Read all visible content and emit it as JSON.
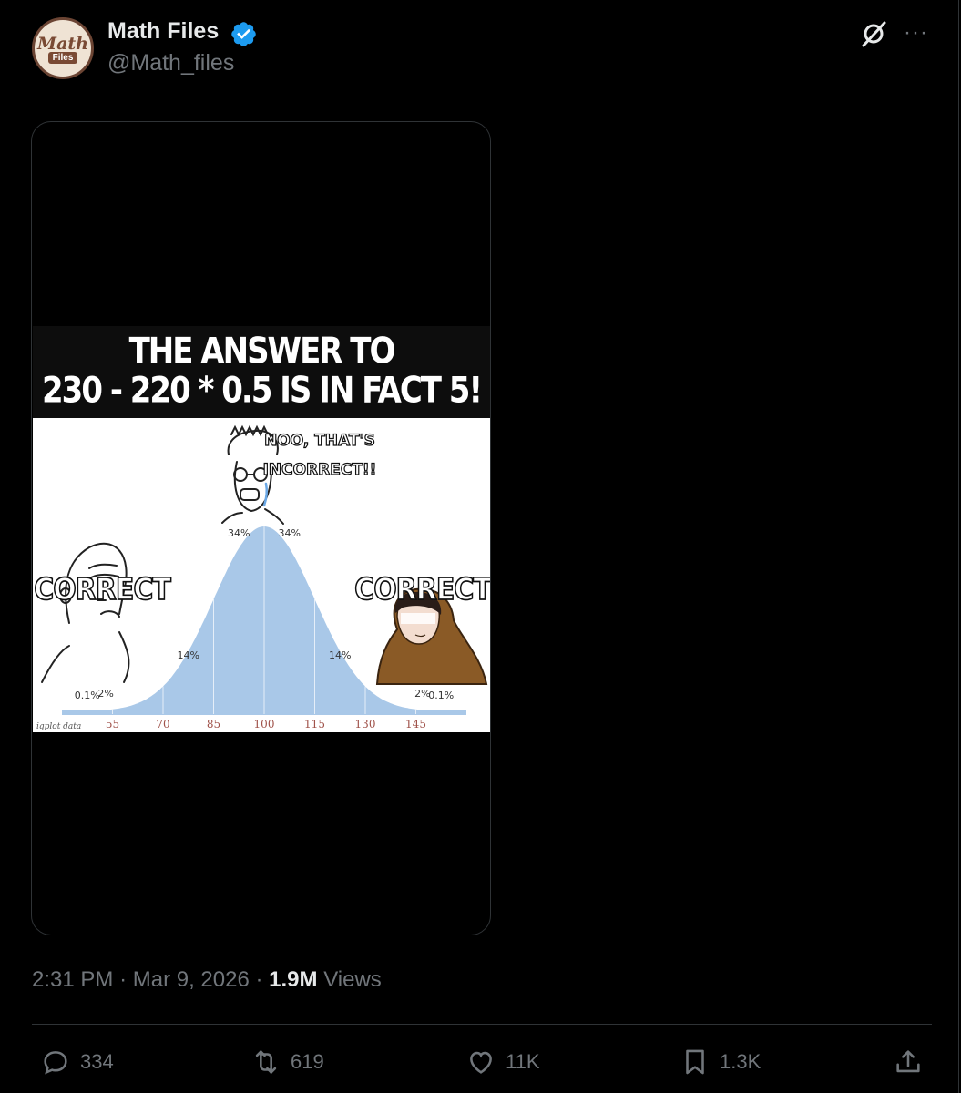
{
  "author": {
    "name": "Math Files",
    "handle": "@Math_files",
    "avatar_text_1": "Math",
    "avatar_text_2": "Files",
    "verified_icon": "verified-badge-icon"
  },
  "meme": {
    "headline_line1": "THE ANSWER TO",
    "headline_line2": "230 - 220 * 0.5 IS IN FACT 5!",
    "center_caption_line1": "NOO, THAT'S",
    "center_caption_line2": "INCORRECT!!",
    "left_caption": "CORRECT",
    "right_caption": "CORRECT",
    "footer_small_text": "iqplot data"
  },
  "chart_data": {
    "type": "area",
    "x_ticks": [
      "55",
      "70",
      "85",
      "100",
      "115",
      "130",
      "145"
    ],
    "regions": [
      {
        "label": "0.1%"
      },
      {
        "label": "2%"
      },
      {
        "label": "14%"
      },
      {
        "label": "34%"
      },
      {
        "label": "34%"
      },
      {
        "label": "14%"
      },
      {
        "label": "2%"
      },
      {
        "label": "0.1%"
      }
    ],
    "mean": 100,
    "sd": 15,
    "fill_color": "#a9c8e8"
  },
  "tweet": {
    "time": "2:31 PM",
    "date": "Mar 9, 2026",
    "views_count": "1.9M",
    "views_label": "Views",
    "sep": "·"
  },
  "actions": {
    "replies": "334",
    "reposts": "619",
    "likes": "11K",
    "bookmarks": "1.3K"
  },
  "colors": {
    "background": "#000000",
    "text": "#e7e9ea",
    "muted": "#71767b",
    "verified": "#1d9bf0"
  }
}
